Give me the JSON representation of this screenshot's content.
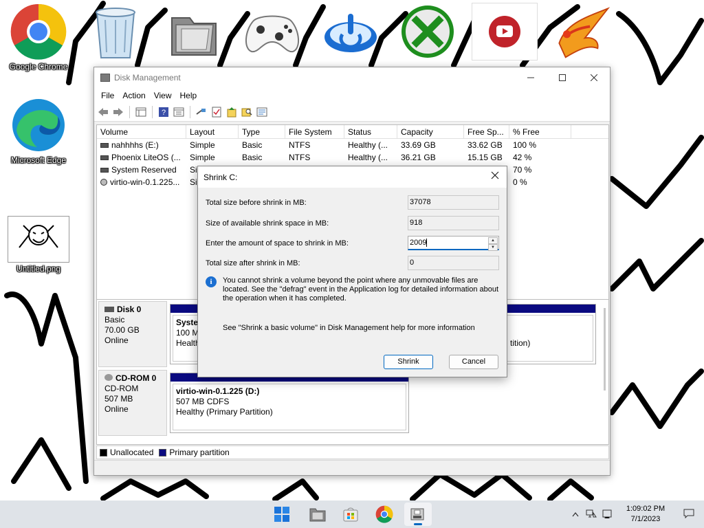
{
  "desktop": {
    "icons": [
      {
        "label": "Google Chrome",
        "icon": "chrome-icon"
      },
      {
        "label": "",
        "icon": "recycle-bin-icon"
      },
      {
        "label": "",
        "icon": "folder-icon"
      },
      {
        "label": "",
        "icon": "gamepad-icon"
      },
      {
        "label": "",
        "icon": "power-icon"
      },
      {
        "label": "",
        "icon": "xbox-icon"
      },
      {
        "label": "",
        "icon": "youtube-icon"
      },
      {
        "label": "",
        "icon": "phoenix-icon"
      },
      {
        "label": "Microsoft Edge",
        "icon": "edge-icon"
      },
      {
        "label": "Untitled.png",
        "icon": "image-file-icon"
      }
    ]
  },
  "disk_management": {
    "title": "Disk Management",
    "menu": [
      "File",
      "Action",
      "View",
      "Help"
    ],
    "columns": [
      "Volume",
      "Layout",
      "Type",
      "File System",
      "Status",
      "Capacity",
      "Free Sp...",
      "% Free"
    ],
    "volumes": [
      {
        "volume": "nahhhhs (E:)",
        "layout": "Simple",
        "type": "Basic",
        "fs": "NTFS",
        "status": "Healthy (...",
        "capacity": "33.69 GB",
        "free": "33.62 GB",
        "pct": "100 %"
      },
      {
        "volume": "Phoenix LiteOS (...",
        "layout": "Simple",
        "type": "Basic",
        "fs": "NTFS",
        "status": "Healthy (...",
        "capacity": "36.21 GB",
        "free": "15.15 GB",
        "pct": "42 %"
      },
      {
        "volume": "System Reserved",
        "layout": "Sir",
        "type": "",
        "fs": "",
        "status": "",
        "capacity": "",
        "free": "",
        "pct": "70 %"
      },
      {
        "volume": "virtio-win-0.1.225...",
        "layout": "Sir",
        "type": "",
        "fs": "",
        "status": "",
        "capacity": "",
        "free": "",
        "pct": "0 %"
      }
    ],
    "disks": [
      {
        "name": "Disk 0",
        "kind": "Basic",
        "size": "70.00 GB",
        "state": "Online",
        "partition": {
          "title": "System",
          "line1": "100 M",
          "line2": "Healthy"
        },
        "partition_right_fragment": "tition)"
      },
      {
        "name": "CD-ROM 0",
        "kind": "CD-ROM",
        "size": "507 MB",
        "state": "Online",
        "partition": {
          "title": "virtio-win-0.1.225  (D:)",
          "line1": "507 MB CDFS",
          "line2": "Healthy (Primary Partition)"
        }
      }
    ],
    "legend": [
      {
        "label": "Unallocated",
        "color": "#000000"
      },
      {
        "label": "Primary partition",
        "color": "#0a0a80"
      }
    ]
  },
  "shrink_dialog": {
    "title": "Shrink C:",
    "fields": [
      {
        "label": "Total size before shrink in MB:",
        "value": "37078"
      },
      {
        "label": "Size of available shrink space in MB:",
        "value": "918"
      },
      {
        "label": "Enter the amount of space to shrink in MB:",
        "value": "2009"
      },
      {
        "label": "Total size after shrink in MB:",
        "value": "0"
      }
    ],
    "info": "You cannot shrink a volume beyond the point where any unmovable files are located. See the \"defrag\" event in the Application log for detailed information about the operation when it has completed.",
    "help": "See \"Shrink a basic volume\" in Disk Management help for more information",
    "shrink_button": "Shrink",
    "cancel_button": "Cancel"
  },
  "taskbar": {
    "apps": [
      "start-icon",
      "file-explorer-icon",
      "store-icon",
      "chrome-icon",
      "disk-management-icon"
    ],
    "time": "1:09:02 PM",
    "date": "7/1/2023"
  }
}
